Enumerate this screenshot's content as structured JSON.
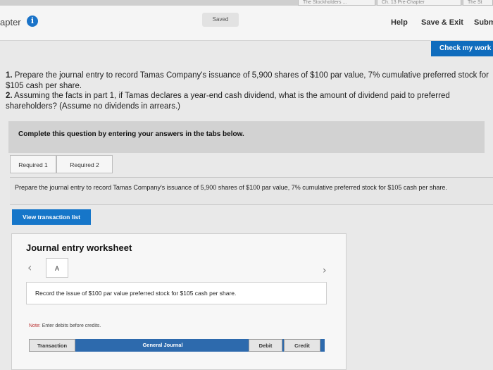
{
  "top_tabs": [
    "The Stockholders ...",
    "Ch. 13 Pre-Chapter",
    "The St"
  ],
  "header": {
    "chapter_label": "apter",
    "info_glyph": "i",
    "saved_label": "Saved",
    "help_label": "Help",
    "save_exit_label": "Save & Exit",
    "submit_label": "Subm"
  },
  "check_button_label": "Check my work",
  "question": {
    "part1_num": "1.",
    "part1_text": "Prepare the journal entry to record Tamas Company's issuance of 5,900 shares of $100 par value, 7% cumulative preferred stock for $105 cash per share.",
    "part2_num": "2.",
    "part2_text": "Assuming the facts in part 1, if Tamas declares a year-end cash dividend, what is the amount of dividend paid to preferred shareholders? (Assume no dividends in arrears.)"
  },
  "complete_prompt": "Complete this question by entering your answers in the tabs below.",
  "tabs": [
    {
      "label": "Required 1",
      "active": true
    },
    {
      "label": "Required 2",
      "active": false
    }
  ],
  "instruction": "Prepare the journal entry to record Tamas Company's issuance of 5,900 shares of $100 par value, 7% cumulative preferred stock for $105 cash per share.",
  "view_transaction_label": "View transaction list",
  "worksheet": {
    "title": "Journal entry worksheet",
    "prev_icon": "chevron-left-icon",
    "next_icon": "chevron-right-icon",
    "page_label": "A",
    "record_text": "Record the issue of $100 par value preferred stock for $105 cash per share.",
    "note_head": "Note:",
    "note_text": "Enter debits before credits.",
    "columns": [
      "Transaction",
      "General Journal",
      "Debit",
      "Credit"
    ]
  },
  "colors": {
    "accent_blue": "#1676c9",
    "check_button": "#0f6cbd",
    "table_header": "#2d6aad"
  }
}
